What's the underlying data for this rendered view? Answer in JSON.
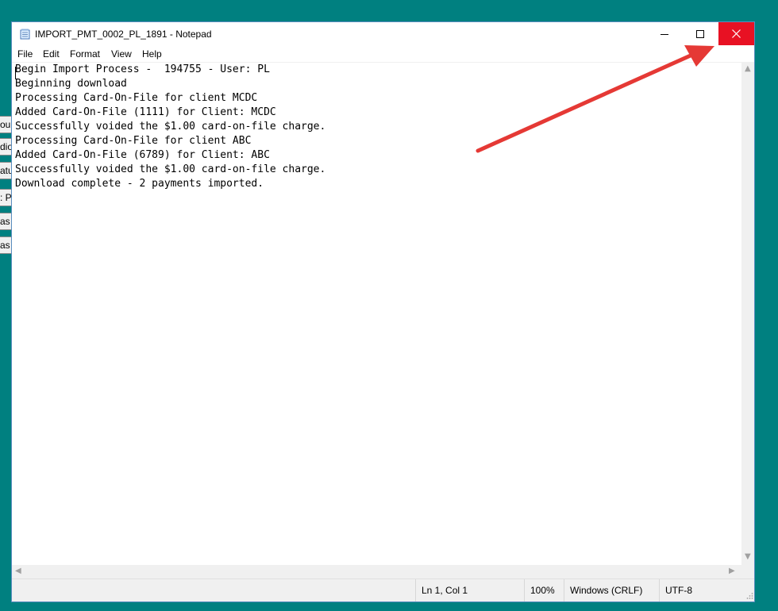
{
  "background_window": {
    "fragments": [
      "ou",
      "dio",
      "atu",
      ": Pa",
      "as",
      "as"
    ]
  },
  "window": {
    "title": "IMPORT_PMT_0002_PL_1891 - Notepad",
    "controls": {
      "minimize_icon": "minimize-icon",
      "maximize_icon": "maximize-icon",
      "close_icon": "close-icon",
      "close_color": "#e81123"
    }
  },
  "menu": {
    "items": [
      "File",
      "Edit",
      "Format",
      "View",
      "Help"
    ]
  },
  "document": {
    "lines": [
      "Begin Import Process -  194755 - User: PL",
      "Beginning download",
      "Processing Card-On-File for client MCDC",
      "Added Card-On-File (1111) for Client: MCDC",
      "Successfully voided the $1.00 card-on-file charge.",
      "Processing Card-On-File for client ABC",
      "Added Card-On-File (6789) for Client: ABC",
      "Successfully voided the $1.00 card-on-file charge.",
      "Download complete - 2 payments imported."
    ]
  },
  "statusbar": {
    "position": "Ln 1, Col 1",
    "zoom": "100%",
    "line_endings": "Windows (CRLF)",
    "encoding": "UTF-8"
  },
  "annotation": {
    "color": "#e53935"
  }
}
